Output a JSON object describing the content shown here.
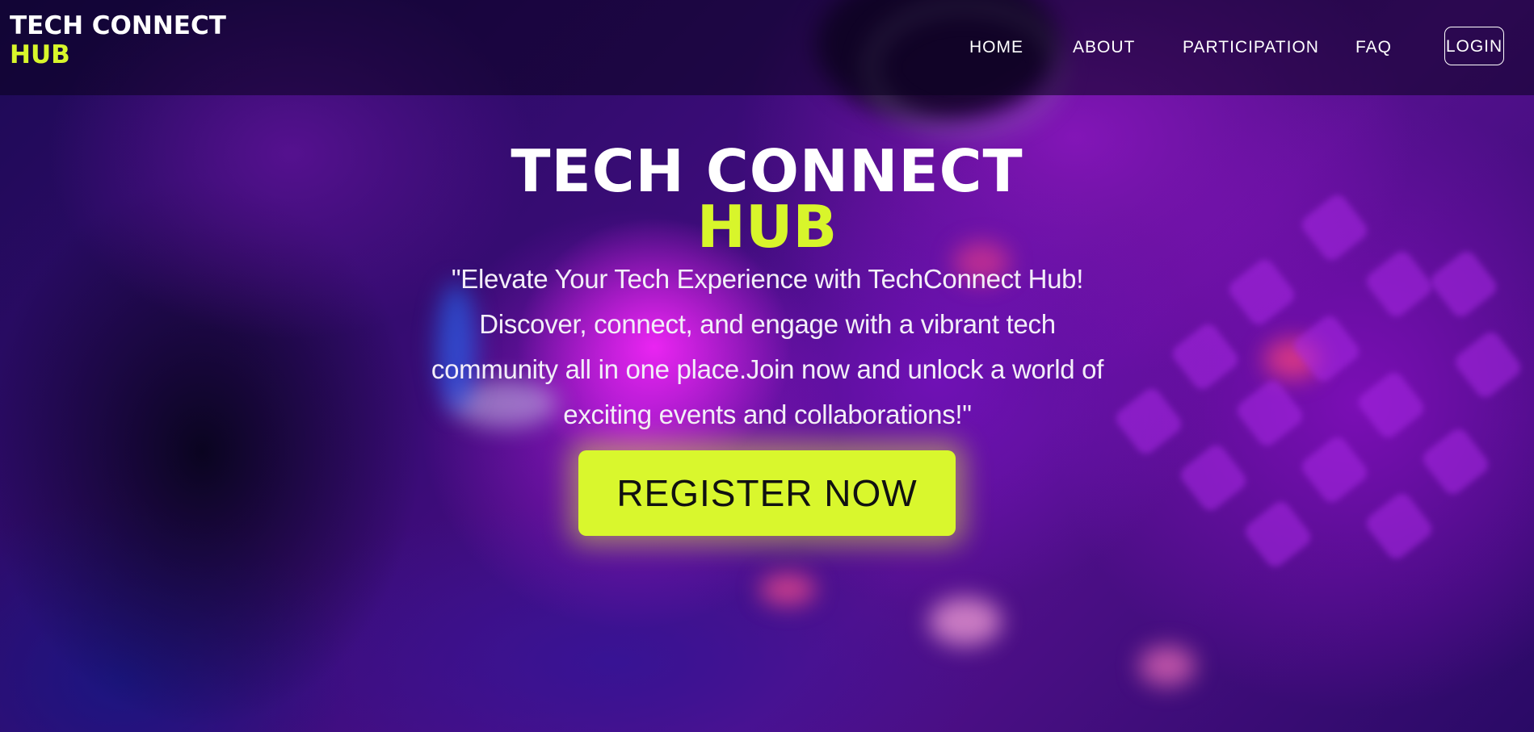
{
  "brand": {
    "line1": "TECH CONNECT",
    "line2": "HUB",
    "accent_color": "#d8f52b"
  },
  "nav": {
    "items": [
      {
        "label": "HOME"
      },
      {
        "label": "ABOUT"
      },
      {
        "label": "PARTICIPATION"
      },
      {
        "label": "FAQ"
      }
    ],
    "login_label": "LOGIN"
  },
  "hero": {
    "title_line1": "TECH CONNECT",
    "title_line2": "HUB",
    "tagline": "\"Elevate Your Tech Experience with TechConnect Hub! Discover, connect, and engage with a vibrant tech community all in one place.Join now and unlock a world of exciting events and collaborations!\"",
    "cta_label": "REGISTER NOW",
    "cta_color": "#d9f72d"
  },
  "theme": {
    "background_tint": "#5a1190",
    "text_color": "#ffffff"
  }
}
